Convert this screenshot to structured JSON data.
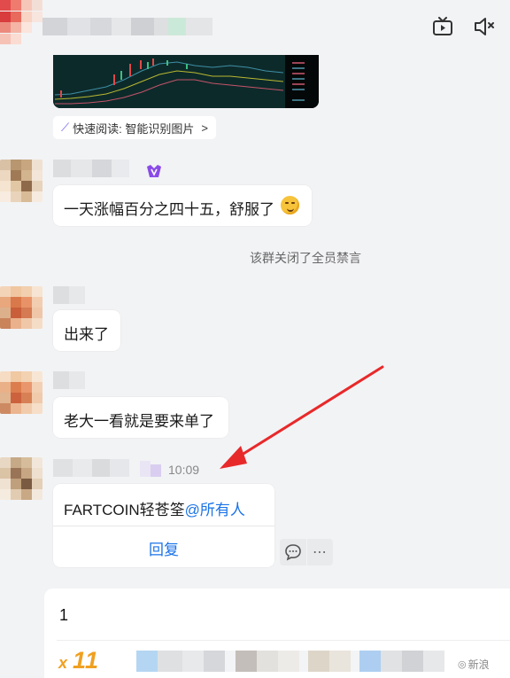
{
  "header": {
    "tv_icon": "tv-icon",
    "speaker_icon": "speaker-icon"
  },
  "image_msg": {
    "quick_read_label": "快速阅读: 智能识别图片",
    "quick_read_arrow": ">"
  },
  "messages": [
    {
      "text": "一天涨幅百分之四十五，舒服了"
    },
    {
      "text": "出来了"
    },
    {
      "text": "老大一看就是要来单了"
    }
  ],
  "system_notice": "该群关闭了全员禁言",
  "last_message": {
    "time": "10:09",
    "text_prefix": "FARTCOIN轻苍筌",
    "mention": "@所有人",
    "reply_label": "回复"
  },
  "input": {
    "value": "1"
  },
  "bottom": {
    "multiplier_x": "x",
    "multiplier_value": "11",
    "watermark": "新浪"
  },
  "colors": {
    "accent": "#1a73e8",
    "arrow": "#e8292a",
    "vip": "#8a4be8",
    "gold": "#f0a020"
  }
}
